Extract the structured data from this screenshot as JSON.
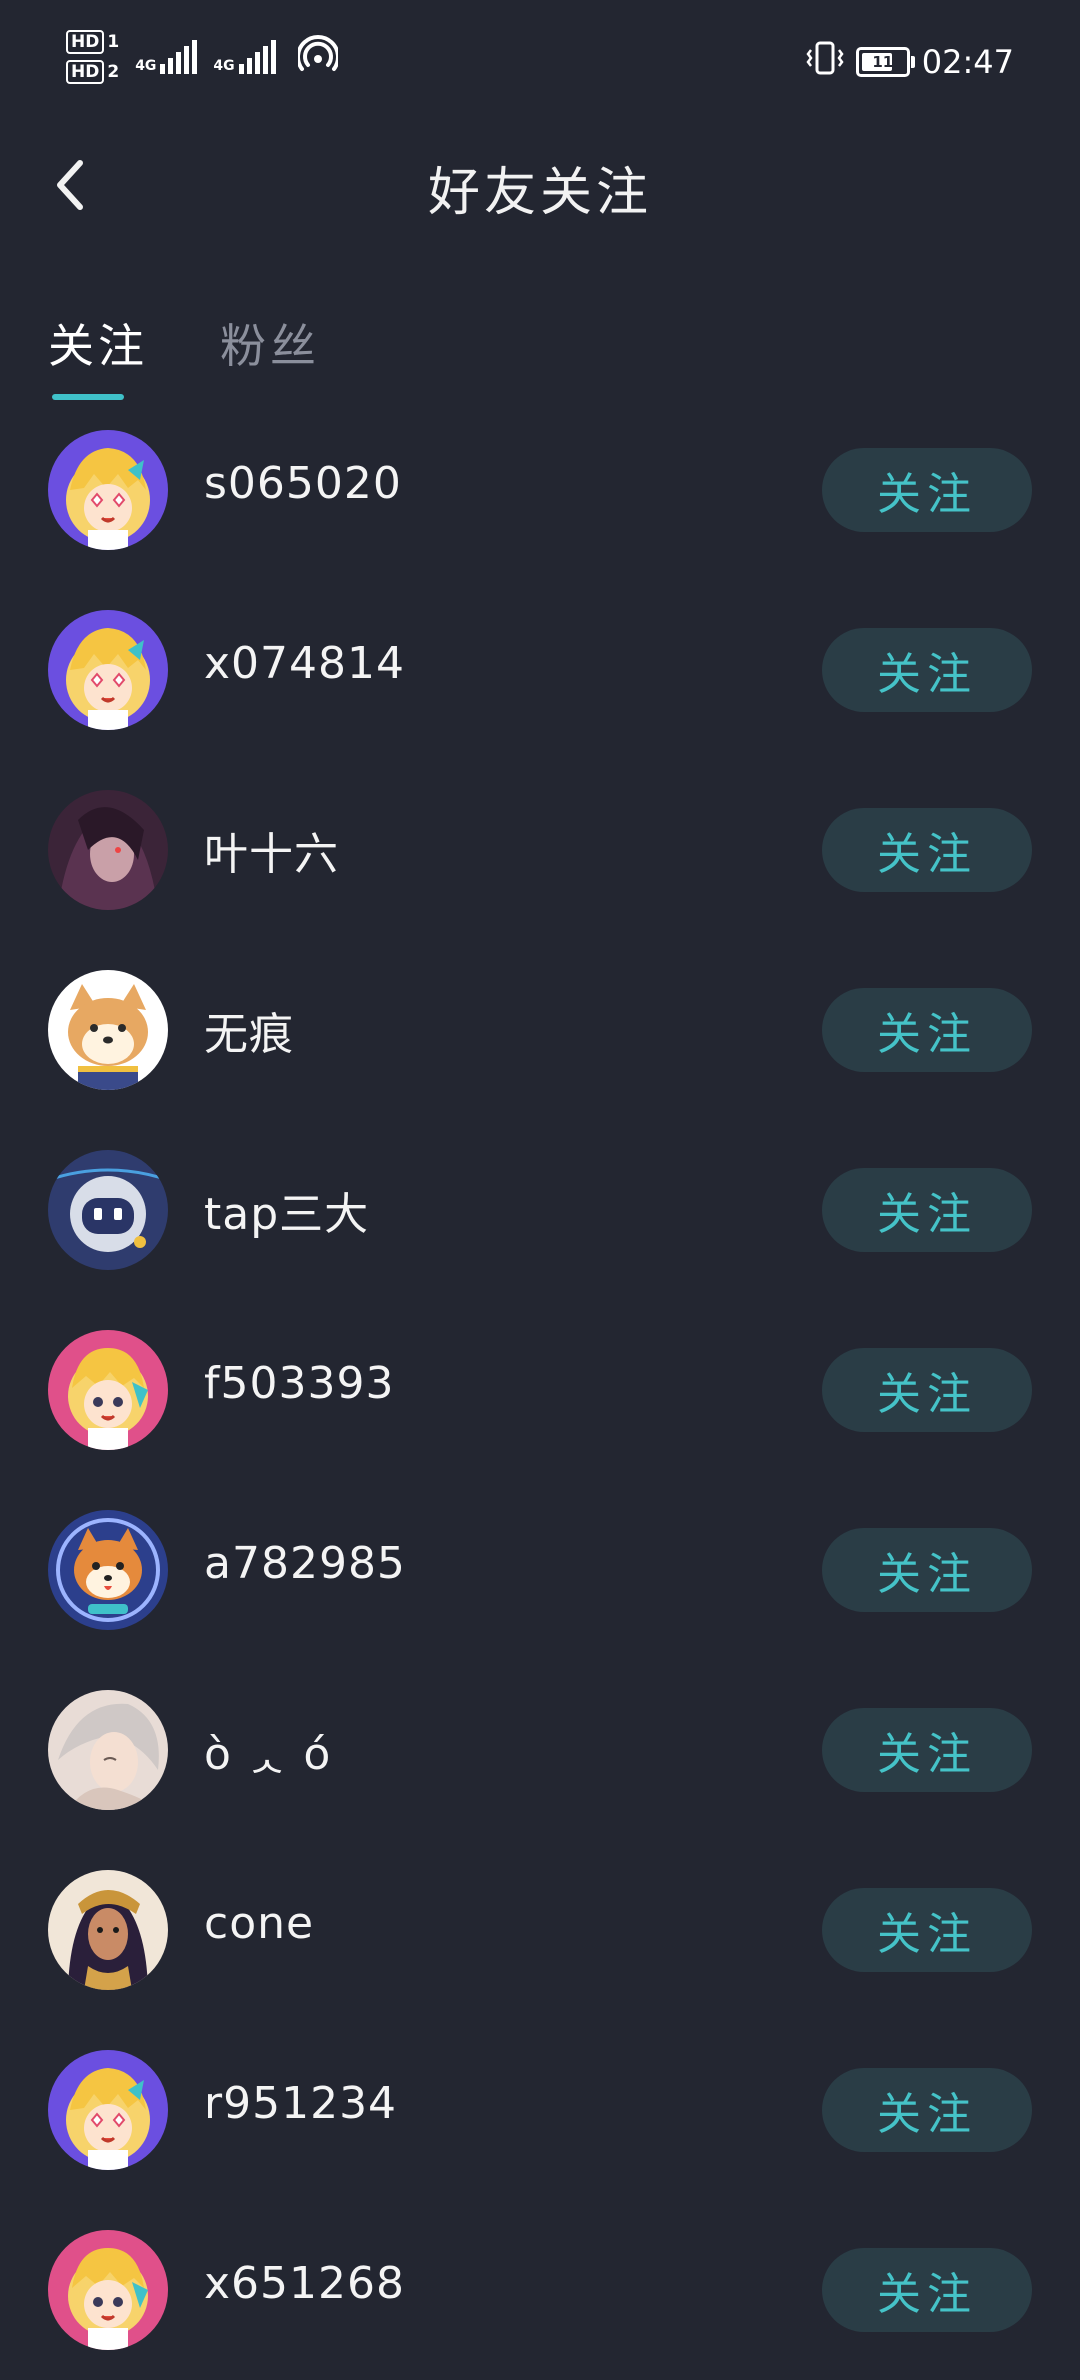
{
  "status_bar": {
    "hd1": "HD",
    "hd1_index": "1",
    "hd2": "HD",
    "hd2_index": "2",
    "net1": "4G",
    "net2": "4G",
    "battery_level": "11",
    "time": "02:47"
  },
  "header": {
    "title": "好友关注"
  },
  "tabs": {
    "follow": "关注",
    "fans": "粉丝",
    "active": "follow"
  },
  "accent_color": "#3fc1c9",
  "users": [
    {
      "name": "s065020",
      "button": "关注",
      "avatar": "anime-girl-star-purple"
    },
    {
      "name": "x074814",
      "button": "关注",
      "avatar": "anime-girl-star-purple"
    },
    {
      "name": "叶十六",
      "button": "关注",
      "avatar": "dark-anime-portrait"
    },
    {
      "name": "无痕",
      "button": "关注",
      "avatar": "shiba-dog-cartoon"
    },
    {
      "name": "tap三大",
      "button": "关注",
      "avatar": "robot-blue"
    },
    {
      "name": "f503393",
      "button": "关注",
      "avatar": "anime-girl-pink"
    },
    {
      "name": "a782985",
      "button": "关注",
      "avatar": "shiba-astronaut"
    },
    {
      "name": "ò ᆺ ó",
      "button": "关注",
      "avatar": "white-hair-portrait"
    },
    {
      "name": "cone",
      "button": "关注",
      "avatar": "warrior-portrait"
    },
    {
      "name": "r951234",
      "button": "关注",
      "avatar": "anime-girl-star-purple"
    },
    {
      "name": "x651268",
      "button": "关注",
      "avatar": "anime-girl-pink"
    }
  ]
}
